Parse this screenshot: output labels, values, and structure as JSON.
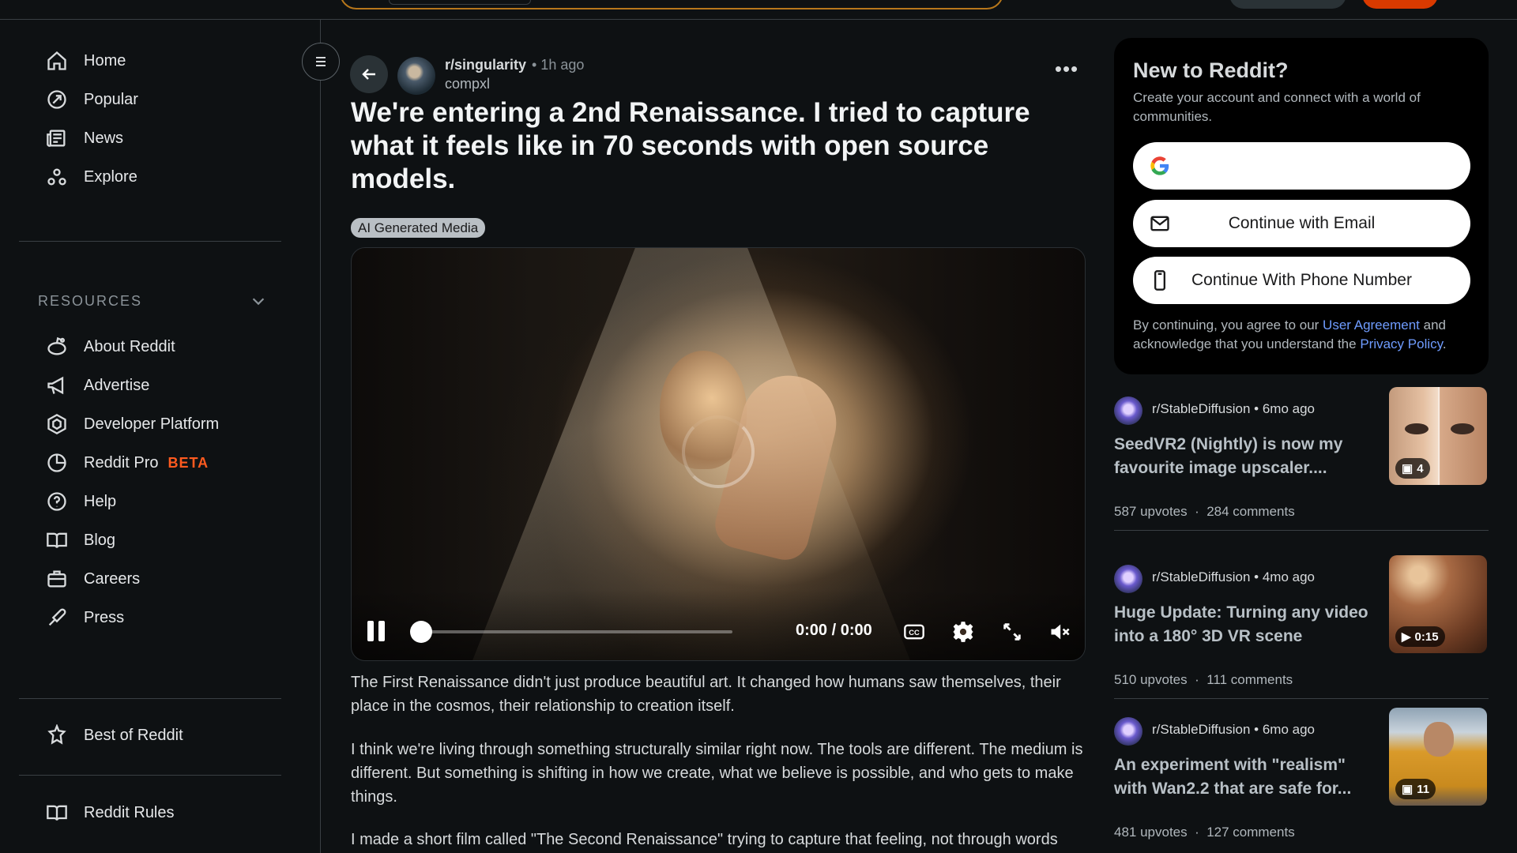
{
  "sidebar": {
    "nav": [
      {
        "label": "Home",
        "icon": "home-icon"
      },
      {
        "label": "Popular",
        "icon": "popular-icon"
      },
      {
        "label": "News",
        "icon": "news-icon"
      },
      {
        "label": "Explore",
        "icon": "explore-icon"
      }
    ],
    "resources_header": "RESOURCES",
    "resources": [
      {
        "label": "About Reddit",
        "icon": "reddit-alien-icon"
      },
      {
        "label": "Advertise",
        "icon": "megaphone-icon"
      },
      {
        "label": "Developer Platform",
        "icon": "developer-platform-icon"
      },
      {
        "label": "Reddit Pro",
        "icon": "reddit-pro-icon",
        "badge": "BETA"
      },
      {
        "label": "Help",
        "icon": "help-icon"
      },
      {
        "label": "Blog",
        "icon": "blog-icon"
      },
      {
        "label": "Careers",
        "icon": "briefcase-icon"
      },
      {
        "label": "Press",
        "icon": "press-icon"
      }
    ],
    "best_of": {
      "label": "Best of Reddit",
      "icon": "best-of-reddit-icon"
    },
    "rules": {
      "label": "Reddit Rules",
      "icon": "rules-icon"
    }
  },
  "post": {
    "subreddit": "r/singularity",
    "time": "• 1h ago",
    "author": "compxl",
    "more": "•••",
    "title": "We're entering a 2nd Renaissance. I tried to capture what it feels like in 70 seconds with open source models.",
    "flair": "AI Generated Media",
    "video": {
      "time_label": "0:00 / 0:00",
      "progress": 0,
      "controls": [
        "pause-icon",
        "captions-icon",
        "settings-icon",
        "fullscreen-icon",
        "mute-icon"
      ]
    },
    "paragraphs": [
      "The First Renaissance didn't just produce beautiful art. It changed how humans saw themselves, their place in the cosmos, their relationship to creation itself.",
      "I think we're living through something structurally similar right now. The tools are different. The medium is different. But something is shifting in how we create, what we believe is possible, and who gets to make things.",
      "I made a short film called \"The Second Renaissance\" trying to capture that feeling, not through words"
    ]
  },
  "signup": {
    "title": "New to Reddit?",
    "subtitle": "Create your account and connect with a world of communities.",
    "google_icon": "google-icon",
    "email_label": "Continue with Email",
    "phone_label": "Continue With Phone Number",
    "legal_prefix": "By continuing, you agree to our ",
    "legal_link1": "User Agreement",
    "legal_mid": " and acknowledge that you understand the ",
    "legal_link2": "Privacy Policy",
    "legal_suffix": "."
  },
  "related": [
    {
      "subreddit": "r/StableDiffusion",
      "time": "• 6mo ago",
      "title": "SeedVR2 (Nightly) is now my favourite image upscaler....",
      "upvotes": "587 upvotes",
      "comments": "284 comments",
      "badge": "4",
      "badge_icon": "gallery-icon"
    },
    {
      "subreddit": "r/StableDiffusion",
      "time": "• 4mo ago",
      "title": "Huge Update: Turning any video into a 180° 3D VR scene",
      "upvotes": "510 upvotes",
      "comments": "111 comments",
      "badge": "0:15",
      "badge_icon": "play-icon"
    },
    {
      "subreddit": "r/StableDiffusion",
      "time": "• 6mo ago",
      "title": "An experiment with \"realism\" with Wan2.2 that are safe for...",
      "upvotes": "481 upvotes",
      "comments": "127 comments",
      "badge": "11",
      "badge_icon": "gallery-icon"
    }
  ],
  "colors": {
    "accent": "#d93a00",
    "beta": "#ff5a1f",
    "link": "#6f9cff",
    "background": "#0e1113"
  }
}
